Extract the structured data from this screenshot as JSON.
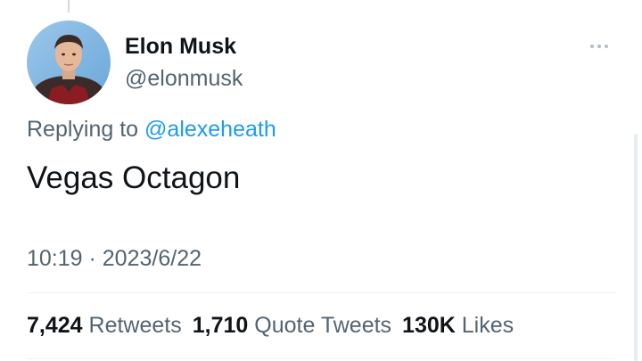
{
  "author": {
    "name": "Elon Musk",
    "handle": "@elonmusk",
    "avatar_icon": "user-photo"
  },
  "reply": {
    "prefix": "Replying to ",
    "mention": "@alexeheath"
  },
  "tweet": {
    "text": "Vegas Octagon",
    "timestamp": "10:19 · 2023/6/22"
  },
  "stats": {
    "retweets_count": "7,424",
    "retweets_label": "Retweets",
    "quotes_count": "1,710",
    "quotes_label": "Quote Tweets",
    "likes_count": "130K",
    "likes_label": "Likes"
  },
  "icons": {
    "more": "more-horizontal-icon"
  },
  "colors": {
    "link": "#1d9bf0",
    "primary_text": "#0f1419",
    "secondary_text": "#536471",
    "divider": "#eff3f4"
  }
}
